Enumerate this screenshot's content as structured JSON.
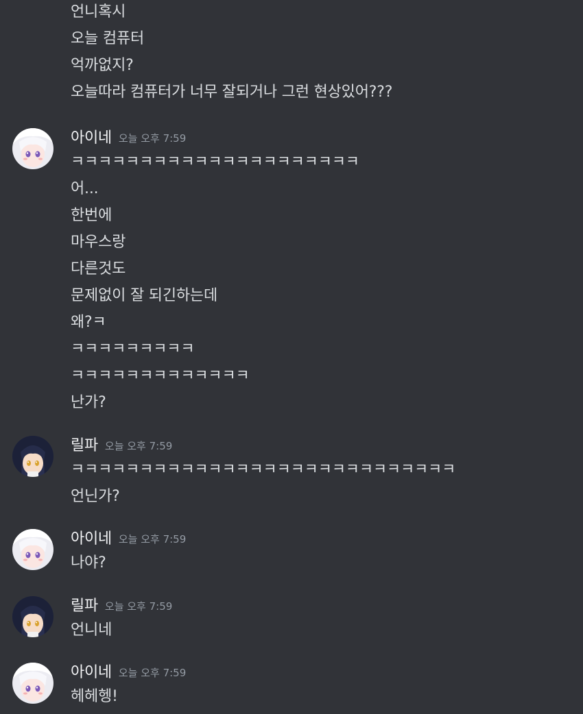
{
  "groups": [
    {
      "author": "",
      "timestamp": "",
      "avatar": "",
      "messages": [
        "언니혹시",
        "오늘 컴퓨터",
        "억까없지?",
        "오늘따라 컴퓨터가 너무 잘되거나 그런 현상있어???"
      ]
    },
    {
      "author": "아이네",
      "timestamp": "오늘 오후 7:59",
      "avatar": "white-haired-avatar",
      "messages": [
        "ㅋㅋㅋㅋㅋㅋㅋㅋㅋㅋㅋㅋㅋㅋㅋㅋㅋㅋㅋㅋㅋ",
        "어...",
        "한번에",
        "마우스랑",
        "다른것도",
        "문제없이 잘 되긴하는데",
        "왜?ㅋ",
        "ㅋㅋㅋㅋㅋㅋㅋㅋㅋ",
        "ㅋㅋㅋㅋㅋㅋㅋㅋㅋㅋㅋㅋㅋ",
        "난가?"
      ]
    },
    {
      "author": "릴파",
      "timestamp": "오늘 오후 7:59",
      "avatar": "dark-haired-avatar",
      "messages": [
        "ㅋㅋㅋㅋㅋㅋㅋㅋㅋㅋㅋㅋㅋㅋㅋㅋㅋㅋㅋㅋㅋㅋㅋㅋㅋㅋㅋㅋ",
        "언닌가?"
      ]
    },
    {
      "author": "아이네",
      "timestamp": "오늘 오후 7:59",
      "avatar": "white-haired-avatar",
      "messages": [
        "나야?"
      ]
    },
    {
      "author": "릴파",
      "timestamp": "오늘 오후 7:59",
      "avatar": "dark-haired-avatar",
      "messages": [
        "언니네"
      ]
    },
    {
      "author": "아이네",
      "timestamp": "오늘 오후 7:59",
      "avatar": "white-haired-avatar",
      "messages": [
        "헤헤헹!"
      ]
    }
  ]
}
